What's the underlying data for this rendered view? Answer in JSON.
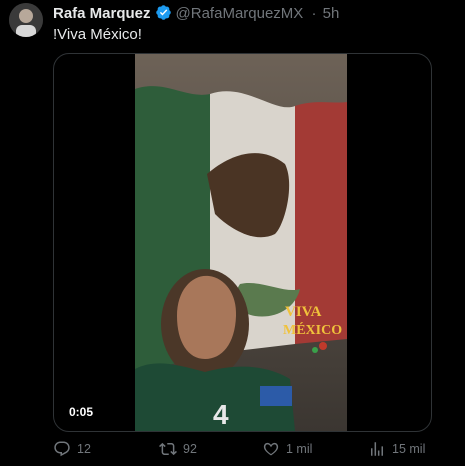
{
  "tweet": {
    "author_name": "Rafa Marquez",
    "handle": "@RafaMarquezMX",
    "separator": "·",
    "time": "5h",
    "text": "!Viva México!",
    "video": {
      "timestamp": "0:05",
      "overlay_text_line1": "VIVA",
      "overlay_text_line2": "MÉXICO",
      "jersey_number": "4"
    },
    "actions": {
      "replies": "12",
      "reposts": "92",
      "likes": "1 mil",
      "views": "15 mil"
    }
  },
  "colors": {
    "background": "#000000",
    "text_primary": "#e7e9ea",
    "text_secondary": "#71767b",
    "verified_blue": "#1d9bf0",
    "border": "#2f3336"
  }
}
